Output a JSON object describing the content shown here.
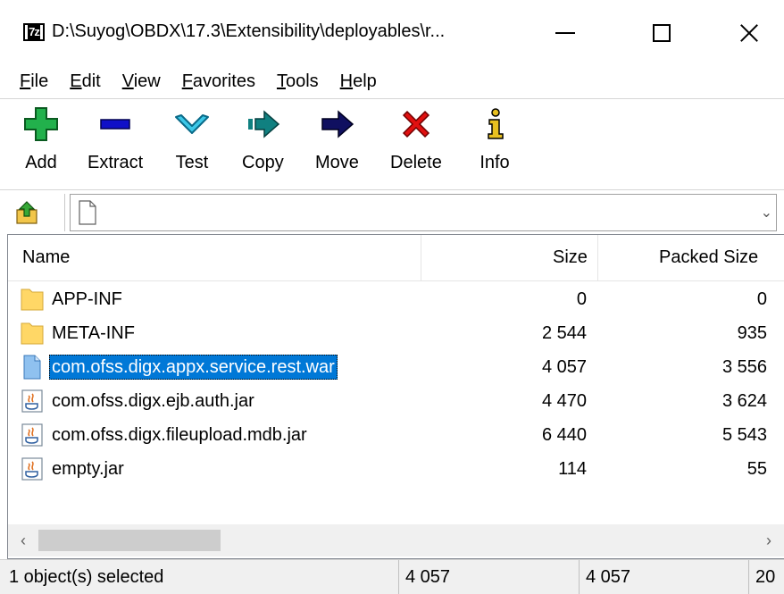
{
  "window": {
    "app_icon_text": "7z",
    "title": "D:\\Suyog\\OBDX\\17.3\\Extensibility\\deployables\\r..."
  },
  "menu": [
    "File",
    "Edit",
    "View",
    "Favorites",
    "Tools",
    "Help"
  ],
  "toolbar": [
    {
      "label": "Add",
      "icon": "plus-icon"
    },
    {
      "label": "Extract",
      "icon": "minus-icon"
    },
    {
      "label": "Test",
      "icon": "check-chevron-icon"
    },
    {
      "label": "Copy",
      "icon": "double-arrow-icon"
    },
    {
      "label": "Move",
      "icon": "arrow-right-icon"
    },
    {
      "label": "Delete",
      "icon": "x-icon"
    },
    {
      "label": "Info",
      "icon": "info-icon"
    }
  ],
  "address": {
    "value": ""
  },
  "columns": {
    "name": "Name",
    "size": "Size",
    "packed": "Packed Size"
  },
  "files": [
    {
      "name": "APP-INF",
      "size": "0",
      "packed": "0",
      "type": "folder"
    },
    {
      "name": "META-INF",
      "size": "2 544",
      "packed": "935",
      "type": "folder"
    },
    {
      "name": "com.ofss.digx.appx.service.rest.war",
      "size": "4 057",
      "packed": "3 556",
      "type": "file",
      "selected": true
    },
    {
      "name": "com.ofss.digx.ejb.auth.jar",
      "size": "4 470",
      "packed": "3 624",
      "type": "jar"
    },
    {
      "name": "com.ofss.digx.fileupload.mdb.jar",
      "size": "6 440",
      "packed": "5 543",
      "type": "jar"
    },
    {
      "name": "empty.jar",
      "size": "114",
      "packed": "55",
      "type": "jar"
    }
  ],
  "status": {
    "selected": "1 object(s) selected",
    "size": "4 057",
    "packed": "4 057",
    "extra": "20"
  },
  "colors": {
    "selection": "#0078d7",
    "add_green": "#22b14c",
    "extract_blue": "#1010c8",
    "test_cyan": "#3cc8e8",
    "copy_teal": "#108080",
    "move_navy": "#101060",
    "delete_red": "#e01010",
    "folder_yellow": "#ffd766"
  }
}
